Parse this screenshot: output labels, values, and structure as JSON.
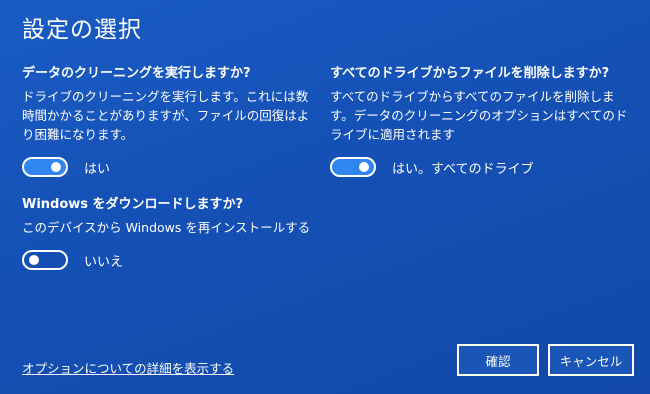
{
  "title": "設定の選択",
  "cleanup": {
    "heading": "データのクリーニングを実行しますか?",
    "description": "ドライブのクリーニングを実行します。これには数時間かかることがありますが、ファイルの回復はより困難になります。",
    "toggle_on": true,
    "toggle_label": "はい"
  },
  "all_drives": {
    "heading": "すべてのドライブからファイルを削除しますか?",
    "description": "すべてのドライブからすべてのファイルを削除します。データのクリーニングのオプションはすべてのドライブに適用されます",
    "toggle_on": true,
    "toggle_label": "はい。すべてのドライブ"
  },
  "download": {
    "heading": "Windows をダウンロードしますか?",
    "description": "このデバイスから Windows を再インストールする",
    "toggle_on": false,
    "toggle_label": "いいえ"
  },
  "details_link": "オプションについての詳細を表示する",
  "confirm_button": "確認",
  "cancel_button": "キャンセル",
  "colors": {
    "background": "#1553b8",
    "toggle_on": "#2f86f0",
    "text": "#ffffff"
  }
}
